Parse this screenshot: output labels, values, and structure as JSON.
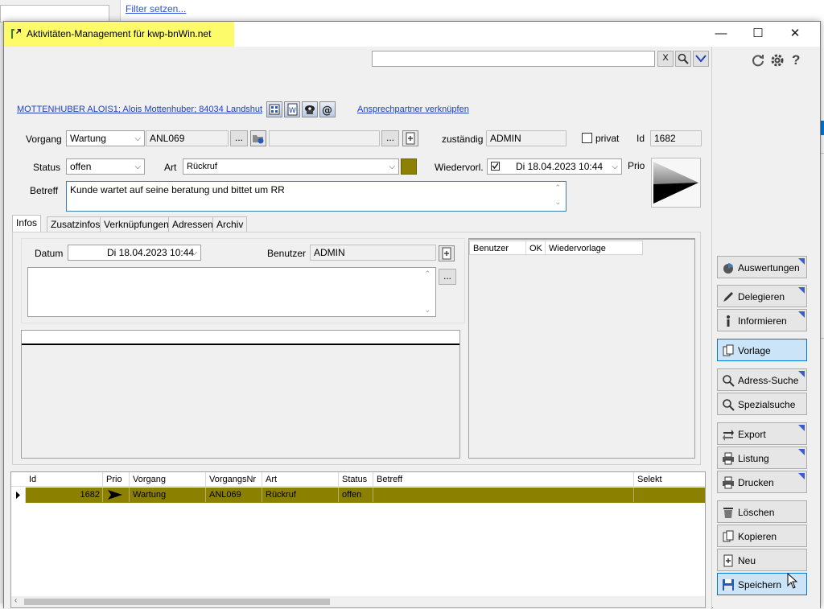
{
  "background": {
    "filter_link": "Filter setzen..."
  },
  "window": {
    "title": "Aktivitäten-Management für kwp-bnWin.net",
    "minimize": "—",
    "maximize": "☐",
    "close": "✕"
  },
  "search": {
    "value": "",
    "clear_label": "X"
  },
  "contact": {
    "address_link": "MOTTENHUBER ALOIS1; Alois Mottenhuber; 84034 Landshut",
    "link_contact": "Ansprechpartner verknüpfen"
  },
  "form": {
    "vorgang_label": "Vorgang",
    "vorgang_value": "Wartung",
    "vorgang_nr": "ANL069",
    "ellipsis": "...",
    "zustaendig_label": "zuständig",
    "zustaendig_value": "ADMIN",
    "privat_label": "privat",
    "id_label": "Id",
    "id_value": "1682",
    "status_label": "Status",
    "status_value": "offen",
    "art_label": "Art",
    "art_value": "Rückruf",
    "wiedervorl_label": "Wiedervorl.",
    "wiedervorl_date": "Di  18.04.2023 10:44",
    "prio_label": "Prio",
    "betreff_label": "Betreff",
    "betreff_value": "Kunde wartet auf seine beratung und bittet um RR"
  },
  "tabs": [
    "Infos",
    "Zusatzinfos",
    "Verknüpfungen",
    "Adressen",
    "Archiv"
  ],
  "infos": {
    "datum_label": "Datum",
    "datum_value": "Di  18.04.2023 10:44",
    "benutzer_label": "Benutzer",
    "benutzer_value": "ADMIN",
    "ellipsis": "..."
  },
  "right_grid": {
    "headers": [
      "Benutzer",
      "OK",
      "Wiedervorlage"
    ]
  },
  "activity_table": {
    "headers": [
      "Id",
      "Prio",
      "Vorgang",
      "VorgangsNr",
      "Art",
      "Status",
      "Betreff",
      "Selekt"
    ],
    "rows": [
      {
        "id": "1682",
        "prio": "",
        "vorgang": "Wartung",
        "vorgangsnr": "ANL069",
        "art": "Rückruf",
        "status": "offen",
        "betreff": "",
        "selekt": ""
      }
    ],
    "selected_row_color": "#8b8000"
  },
  "toolbar_top": {
    "help": "?"
  },
  "side_buttons": [
    {
      "label": "Auswertungen",
      "icon": "chart-icon"
    },
    {
      "label": "Delegieren",
      "icon": "pen-icon"
    },
    {
      "label": "Informieren",
      "icon": "info-icon"
    },
    {
      "label": "Vorlage",
      "icon": "copy-icon"
    },
    {
      "label": "Adress-Suche",
      "icon": "search-icon"
    },
    {
      "label": "Spezialsuche",
      "icon": "search-icon"
    },
    {
      "label": "Export",
      "icon": "arrows-icon"
    },
    {
      "label": "Listung",
      "icon": "printer-icon"
    },
    {
      "label": "Drucken",
      "icon": "printer-icon"
    },
    {
      "label": "Löschen",
      "icon": "trash-icon"
    },
    {
      "label": "Kopieren",
      "icon": "copy-icon"
    },
    {
      "label": "Neu",
      "icon": "new-doc-icon"
    },
    {
      "label": "Speichern",
      "icon": "save-icon"
    }
  ],
  "colors": {
    "title_highlight": "#fdfb6a",
    "art_color": "#8b8000",
    "link": "#1f3fbf",
    "accent_triangle": "#3b5cc9"
  }
}
